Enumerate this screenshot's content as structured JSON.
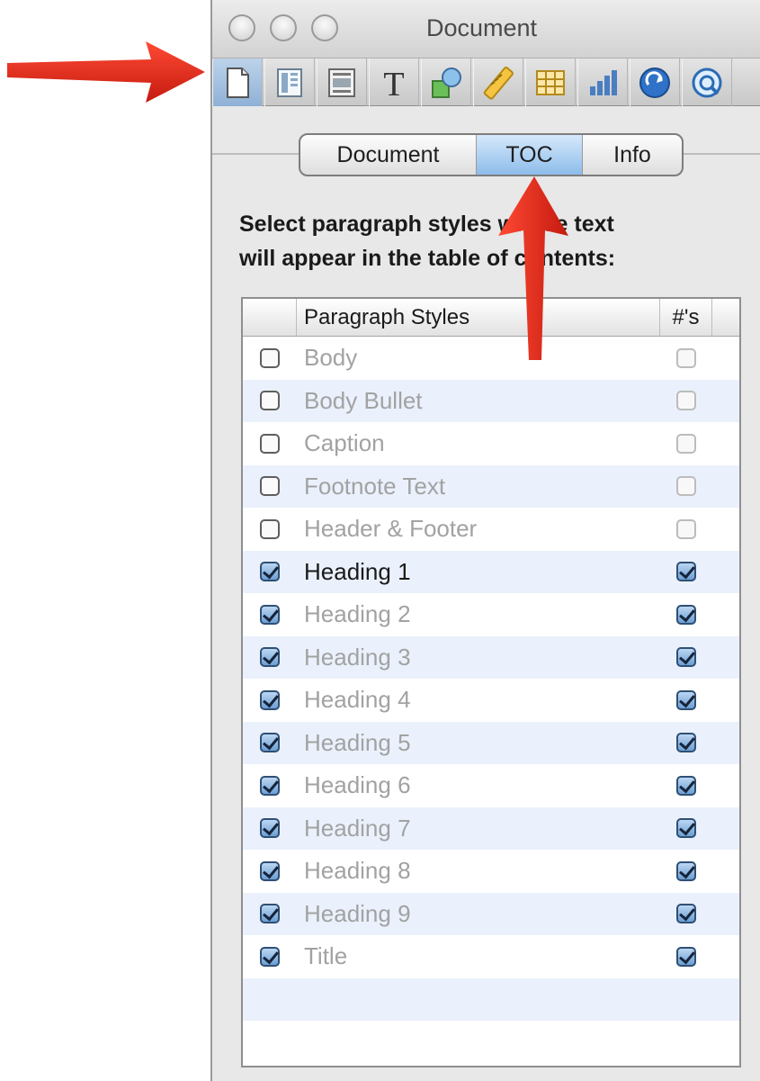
{
  "window": {
    "title": "Document"
  },
  "toolbar": {
    "buttons": [
      {
        "icon": "document-inspector-icon",
        "active": true
      },
      {
        "icon": "layout-inspector-icon",
        "active": false
      },
      {
        "icon": "wrap-inspector-icon",
        "active": false
      },
      {
        "icon": "text-inspector-icon",
        "active": false
      },
      {
        "icon": "graphic-inspector-icon",
        "active": false
      },
      {
        "icon": "metrics-inspector-icon",
        "active": false
      },
      {
        "icon": "table-inspector-icon",
        "active": false
      },
      {
        "icon": "chart-inspector-icon",
        "active": false
      },
      {
        "icon": "hyperlink-inspector-icon",
        "active": false
      },
      {
        "icon": "quicktime-inspector-icon",
        "active": false
      }
    ],
    "text_icon_glyph": "T"
  },
  "tabs": [
    {
      "label": "Document",
      "selected": false
    },
    {
      "label": "TOC",
      "selected": true
    },
    {
      "label": "Info",
      "selected": false
    }
  ],
  "instructions": "Select paragraph styles whose text\nwill appear in the table of contents:",
  "table": {
    "headers": {
      "name": "Paragraph Styles",
      "numbers": "#'s"
    },
    "rows": [
      {
        "name": "Body",
        "checked": false,
        "numbered": false,
        "enabled": false
      },
      {
        "name": "Body Bullet",
        "checked": false,
        "numbered": false,
        "enabled": false
      },
      {
        "name": "Caption",
        "checked": false,
        "numbered": false,
        "enabled": false
      },
      {
        "name": "Footnote Text",
        "checked": false,
        "numbered": false,
        "enabled": false
      },
      {
        "name": "Header & Footer",
        "checked": false,
        "numbered": false,
        "enabled": false
      },
      {
        "name": "Heading 1",
        "checked": true,
        "numbered": true,
        "enabled": true
      },
      {
        "name": "Heading 2",
        "checked": true,
        "numbered": true,
        "enabled": false
      },
      {
        "name": "Heading 3",
        "checked": true,
        "numbered": true,
        "enabled": false
      },
      {
        "name": "Heading 4",
        "checked": true,
        "numbered": true,
        "enabled": false
      },
      {
        "name": "Heading 5",
        "checked": true,
        "numbered": true,
        "enabled": false
      },
      {
        "name": "Heading 6",
        "checked": true,
        "numbered": true,
        "enabled": false
      },
      {
        "name": "Heading 7",
        "checked": true,
        "numbered": true,
        "enabled": false
      },
      {
        "name": "Heading 8",
        "checked": true,
        "numbered": true,
        "enabled": false
      },
      {
        "name": "Heading 9",
        "checked": true,
        "numbered": true,
        "enabled": false
      },
      {
        "name": "Title",
        "checked": true,
        "numbered": true,
        "enabled": false
      }
    ]
  },
  "colors": {
    "annotation_arrow": "#e0271a",
    "selected_tab": "#8dbdea",
    "row_alternate": "#eaf1fc",
    "checkbox_on": "#6c9fd3"
  }
}
